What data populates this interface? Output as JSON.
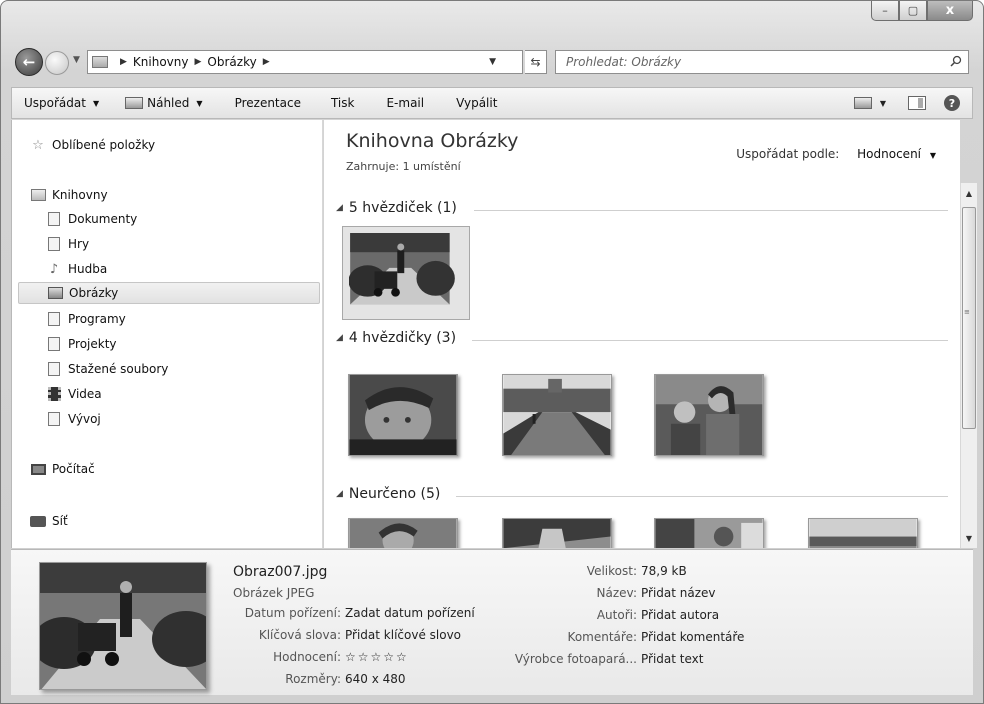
{
  "window": {
    "caption": {
      "minimize": "–",
      "maximize": "▢",
      "close": "x"
    }
  },
  "address_bar": {
    "breadcrumbs": [
      "Knihovny",
      "Obrázky"
    ],
    "search_placeholder": "Prohledat: Obrázky"
  },
  "toolbar": {
    "organize": "Uspořádat",
    "preview": "Náhled",
    "slideshow": "Prezentace",
    "print": "Tisk",
    "email": "E-mail",
    "burn": "Vypálit"
  },
  "sidebar": {
    "favorites": "Oblíbené položky",
    "libraries": "Knihovny",
    "library_items": [
      "Dokumenty",
      "Hry",
      "Hudba",
      "Obrázky",
      "Programy",
      "Projekty",
      "Stažené soubory",
      "Videa",
      "Vývoj"
    ],
    "selected_item": "Obrázky",
    "computer": "Počítač",
    "network": "Síť"
  },
  "content": {
    "title": "Knihovna Obrázky",
    "subtitle_prefix": "Zahrnuje:",
    "subtitle_link": "1 umístění",
    "sort_label": "Uspořádat podle:",
    "sort_value": "Hodnocení",
    "groups": [
      {
        "label": "5 hvězdiček (1)",
        "count": 1
      },
      {
        "label": "4 hvězdičky (3)",
        "count": 3
      },
      {
        "label": "Neurčeno (5)",
        "count": 5
      }
    ]
  },
  "details": {
    "filename": "Obraz007.jpg",
    "filetype": "Obrázek JPEG",
    "left_props": [
      {
        "label": "Datum pořízení:",
        "value": "Zadat datum pořízení"
      },
      {
        "label": "Klíčová slova:",
        "value": "Přidat klíčové slovo"
      },
      {
        "label": "Hodnocení:",
        "value": "☆☆☆☆☆"
      },
      {
        "label": "Rozměry:",
        "value": "640 x 480"
      }
    ],
    "right_props": [
      {
        "label": "Velikost:",
        "value": "78,9 kB"
      },
      {
        "label": "Název:",
        "value": "Přidat název"
      },
      {
        "label": "Autoři:",
        "value": "Přidat autora"
      },
      {
        "label": "Komentáře:",
        "value": "Přidat komentáře"
      },
      {
        "label": "Výrobce fotoapará...",
        "value": "Přidat text"
      }
    ]
  },
  "colors": {
    "accent_selection": "#e2e2e2",
    "chrome": "#d4d4d4"
  }
}
